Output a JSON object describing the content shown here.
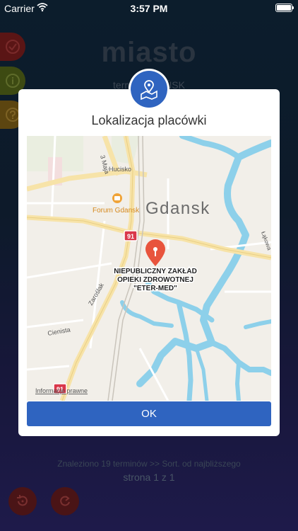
{
  "status_bar": {
    "carrier": "Carrier",
    "time": "3:57 PM"
  },
  "background": {
    "title": "miasto",
    "subtitle": "termin GDAŃSK",
    "found": "Znaleziono 19 terminów   >>   Sort. od najbliższego",
    "page": "strona 1 z 1"
  },
  "modal": {
    "title": "Lokalizacja placówki",
    "ok_label": "OK"
  },
  "map": {
    "city_label": "Gdansk",
    "place_label_1": "NIEPUBLICZNY ZAKŁAD",
    "place_label_2": "OPIEKI ZDROWOTNEJ",
    "place_label_3": "\"ETER-MED\"",
    "poi_label": "Forum Gdansk",
    "street_hucisko": "Hucisko",
    "street_3maja": "3 Maja",
    "street_zaroslak": "Zaroślak",
    "street_cienista": "Cienista",
    "street_lakowa": "Łąkowa",
    "road_91_top": "91",
    "road_91_bottom": "91",
    "legal": "Informacje prawne"
  },
  "colors": {
    "accent": "#2f64c0",
    "water": "#8dd0ea",
    "road_major": "#f7e3a8",
    "pin": "#e8543d"
  }
}
